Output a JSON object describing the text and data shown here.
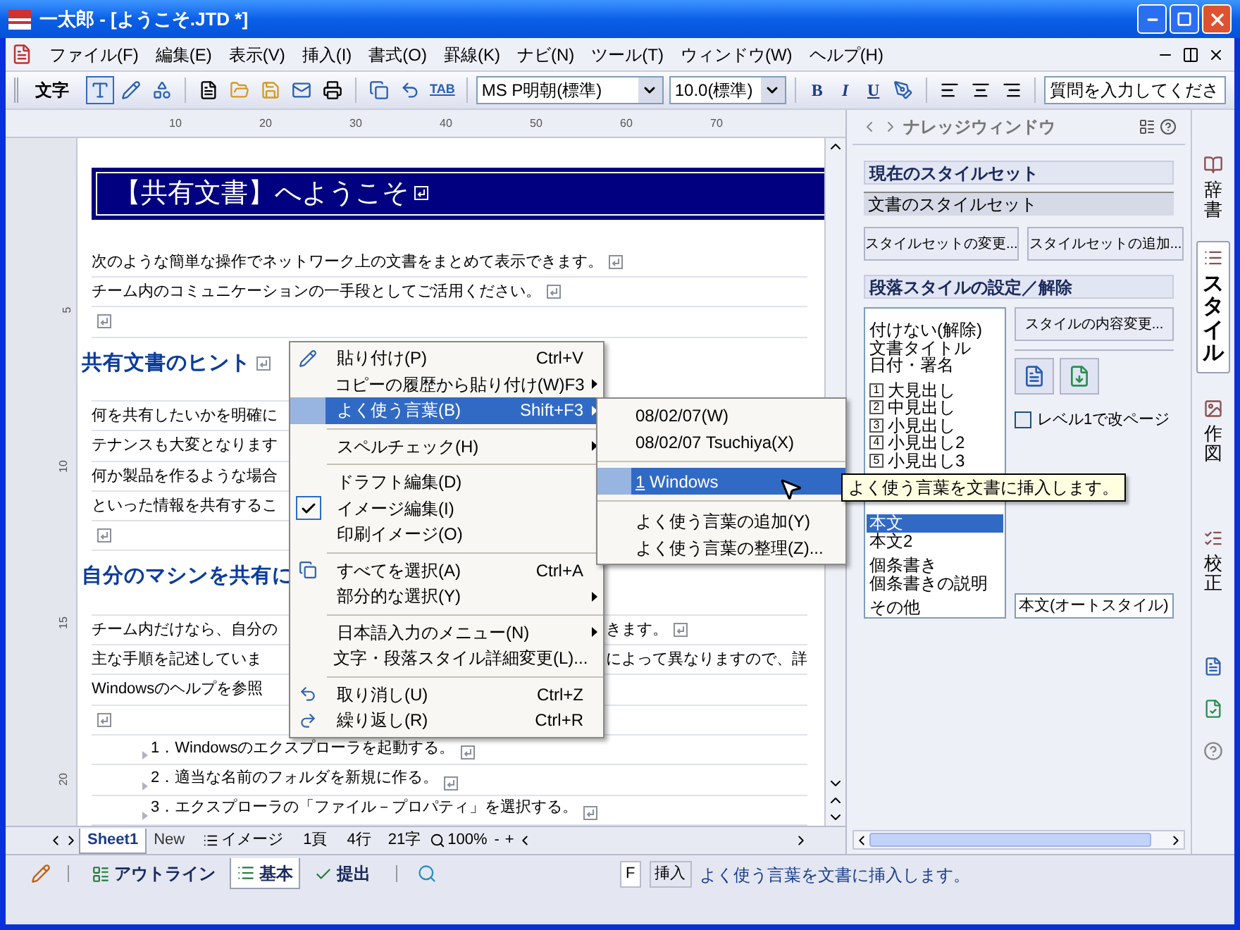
{
  "window": {
    "title": "一太郎 - [ようこそ.JTD *]"
  },
  "menu_bar": [
    "ファイル(F)",
    "編集(E)",
    "表示(V)",
    "挿入(I)",
    "書式(O)",
    "罫線(K)",
    "ナビ(N)",
    "ツール(T)",
    "ウィンドウ(W)",
    "ヘルプ(H)"
  ],
  "toolbar": {
    "label": "文字",
    "mode_buttons": [
      {
        "selected": true
      },
      {
        "selected": false
      },
      {
        "selected": false
      }
    ],
    "tab_button": "TAB",
    "font": "MS P明朝(標準)",
    "size": "10.0(標準)",
    "bold": "B",
    "italic": "I",
    "underline": "U",
    "help_field": {
      "placeholder": "質問を入力してくださ"
    }
  },
  "ruler": {
    "ticks": [
      "10",
      "20",
      "30",
      "40",
      "50",
      "60",
      "70"
    ],
    "vertical_ticks": [
      "5",
      "10",
      "15",
      "20"
    ]
  },
  "document": {
    "lines": [
      {
        "kind": "title",
        "text": "【共有文書】へようこそ",
        "mark": true
      },
      {
        "kind": "body",
        "text": "次のような簡単な操作でネットワーク上の文書をまとめて表示できます。",
        "mark": true
      },
      {
        "kind": "body",
        "text": "チーム内のコミュニケーションの一手段としてご活用ください。",
        "mark": true
      },
      {
        "kind": "body",
        "mark": true
      },
      {
        "kind": "heading",
        "text": "共有文書のヒント",
        "mark": true
      },
      {
        "kind": "body",
        "text": "何を共有したいかを明確に",
        "mark": false
      },
      {
        "kind": "body",
        "text": "テナンスも大変となります",
        "mark": false
      },
      {
        "kind": "body",
        "text": "何か製品を作るような場合",
        "mark": false
      },
      {
        "kind": "body",
        "text": "といった情報を共有するこ",
        "mark": false
      },
      {
        "kind": "body",
        "mark": true
      },
      {
        "kind": "heading",
        "text": "自分のマシンを共有に",
        "mark": false
      },
      {
        "kind": "body",
        "text": "チーム内だけなら、自分の",
        "right": "きます。",
        "mark": true
      },
      {
        "kind": "body",
        "text": "主な手順を記述していま",
        "right": "によって異なりますので、詳",
        "mark": false
      },
      {
        "kind": "body",
        "text": "Windowsのヘルプを参照",
        "mark": false
      },
      {
        "kind": "body",
        "mark": true
      },
      {
        "kind": "list",
        "text": "1．Windowsのエクスプローラを起動する。",
        "mark": true
      },
      {
        "kind": "list",
        "text": "2．適当な名前のフォルダを新規に作る。",
        "mark": true
      },
      {
        "kind": "list",
        "text": "3．エクスプローラの「ファイル－プロパティ」を選択する。",
        "mark": true
      }
    ]
  },
  "context_menu": {
    "items": [
      {
        "kind": "item",
        "label": "貼り付け(P)",
        "shortcut": "Ctrl+V",
        "submenu": false,
        "checked": false,
        "selected": false
      },
      {
        "kind": "item",
        "label": "コピーの履歴から貼り付け(W)",
        "shortcut": "F3",
        "submenu": true,
        "checked": false,
        "selected": false
      },
      {
        "kind": "item",
        "label": "よく使う言葉(B)",
        "shortcut": "Shift+F3",
        "submenu": true,
        "checked": false,
        "selected": true
      },
      {
        "kind": "separator"
      },
      {
        "kind": "item",
        "label": "スペルチェック(H)",
        "submenu": true,
        "checked": false,
        "selected": false
      },
      {
        "kind": "separator"
      },
      {
        "kind": "item",
        "label": "ドラフト編集(D)",
        "submenu": false,
        "checked": false,
        "selected": false
      },
      {
        "kind": "item",
        "label": "イメージ編集(I)",
        "submenu": false,
        "checked": true,
        "selected": false
      },
      {
        "kind": "item",
        "label": "印刷イメージ(O)",
        "submenu": false,
        "checked": false,
        "selected": false
      },
      {
        "kind": "separator"
      },
      {
        "kind": "item",
        "label": "すべてを選択(A)",
        "shortcut": "Ctrl+A",
        "submenu": false,
        "checked": false,
        "selected": false
      },
      {
        "kind": "item",
        "label": "部分的な選択(Y)",
        "submenu": true,
        "checked": false,
        "selected": false
      },
      {
        "kind": "separator"
      },
      {
        "kind": "item",
        "label": "日本語入力のメニュー(N)",
        "submenu": true,
        "checked": false,
        "selected": false
      },
      {
        "kind": "item",
        "label": "文字・段落スタイル詳細変更(L)...",
        "submenu": false,
        "checked": false,
        "selected": false
      },
      {
        "kind": "separator"
      },
      {
        "kind": "item",
        "label": "取り消し(U)",
        "shortcut": "Ctrl+Z",
        "submenu": false,
        "checked": false,
        "selected": false
      },
      {
        "kind": "item",
        "label": "繰り返し(R)",
        "shortcut": "Ctrl+R",
        "submenu": false,
        "checked": false,
        "selected": false
      }
    ]
  },
  "submenu": {
    "items": [
      {
        "kind": "item",
        "label": "08/02/07(W)",
        "selected": false
      },
      {
        "kind": "item",
        "label": "08/02/07 Tsuchiya(X)",
        "selected": false
      },
      {
        "kind": "separator"
      },
      {
        "kind": "item",
        "number": "1",
        "label": "Windows",
        "selected": true
      },
      {
        "kind": "separator"
      },
      {
        "kind": "item",
        "label": "よく使う言葉の追加(Y)",
        "selected": false
      },
      {
        "kind": "item",
        "label": "よく使う言葉の整理(Z)...",
        "selected": false
      }
    ]
  },
  "tooltip": "よく使う言葉を文書に挿入します。",
  "knowledge_window": {
    "title": "ナレッジウィンドウ",
    "style_set_header": "現在のスタイルセット",
    "style_set_value": "文書のスタイルセット",
    "style_set_buttons": [
      "スタイルセットの変更...",
      "スタイルセットの追加..."
    ],
    "paragraph_header": "段落スタイルの設定／解除",
    "style_groups": [
      [
        {
          "label": "付けない(解除)",
          "selected": false
        },
        {
          "label": "文書タイトル",
          "selected": false
        },
        {
          "label": "日付・署名",
          "selected": false
        }
      ],
      [
        {
          "number": "1",
          "label": "大見出し",
          "selected": false
        },
        {
          "number": "2",
          "label": "中見出し",
          "selected": false
        },
        {
          "number": "3",
          "label": "小見出し",
          "selected": false
        },
        {
          "number": "4",
          "label": "小見出し2",
          "selected": false
        },
        {
          "number": "5",
          "label": "小見出し3",
          "selected": false
        }
      ],
      [
        {
          "label": "本文",
          "selected": true
        },
        {
          "label": "本文2",
          "selected": false
        }
      ],
      [
        {
          "label": "個条書き",
          "selected": false
        },
        {
          "label": "個条書きの説明",
          "selected": false
        }
      ],
      [
        {
          "label": "その他",
          "selected": false
        }
      ]
    ],
    "content_button": "スタイルの内容変更...",
    "page_break": {
      "label": "レベル1で改ページ",
      "checked": false
    },
    "current_style": "本文(オートスタイル)"
  },
  "side_tabs": [
    {
      "label": "辞書",
      "selected": false
    },
    {
      "label": "スタイル",
      "selected": true
    },
    {
      "label": "作図",
      "selected": false
    },
    {
      "label": "校正",
      "selected": false
    }
  ],
  "sheet_tabs": [
    {
      "label": "Sheet1",
      "selected": true
    },
    {
      "label": "New",
      "selected": false
    }
  ],
  "doc_status": {
    "view": "イメージ",
    "page": "1頁",
    "line": "4行",
    "column": "21字",
    "zoom": "100%",
    "zoom_out": "-",
    "zoom_in": "+"
  },
  "bottom_tabs": [
    {
      "label": "アウトライン",
      "selected": false
    },
    {
      "label": "基本",
      "selected": true
    },
    {
      "label": "提出",
      "selected": false
    }
  ],
  "status_bar": {
    "key": "F",
    "mode": "挿入",
    "message": "よく使う言葉を文書に挿入します。"
  }
}
